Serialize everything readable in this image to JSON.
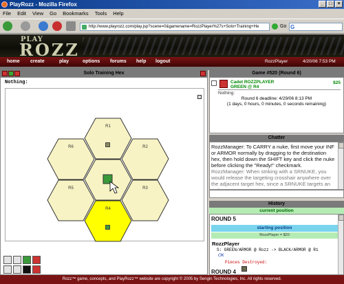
{
  "window": {
    "title": "PlayRozz - Mozilla Firefox",
    "buttons": [
      "_",
      "□",
      "×"
    ]
  },
  "menu": [
    "File",
    "Edit",
    "View",
    "Go",
    "Bookmarks",
    "Tools",
    "Help"
  ],
  "address": {
    "url": "http://www.playrozz.com/play.jsp?scene=0&gamename=RozzPlayer%27s+Solo+Training+He",
    "go_label": "Go",
    "search_placeholder": ""
  },
  "banner": {
    "logo_top": "PLAY",
    "logo_main": "ROZZ"
  },
  "nav": {
    "tabs": [
      "home",
      "create",
      "play",
      "options",
      "forums",
      "help",
      "logout"
    ],
    "user": "RozzPlayer",
    "datetime": "4/20/06 7:53 PM"
  },
  "board": {
    "title": "Solo Training Hex",
    "status": "Nothing:",
    "hexes": [
      {
        "label": "R1",
        "fill": "#f7f3c4"
      },
      {
        "label": "R6",
        "fill": "#f7f3c4"
      },
      {
        "label": "R2",
        "fill": "#f7f3c4"
      },
      {
        "label": "",
        "fill": "#f7f3c4"
      },
      {
        "label": "R5",
        "fill": "#f7f3c4"
      },
      {
        "label": "R3",
        "fill": "#f7f3c4"
      },
      {
        "label": "R4",
        "fill": "#ffff00"
      }
    ]
  },
  "game": {
    "title": "Game #520 (Round 6)",
    "player_rank": "Cadet ROZZPLAYER",
    "player_unit": "GREEN @ R4",
    "cash": "$25",
    "status": "Nothing:",
    "deadline": "Round 6 deadline: 4/29/06 8:13 PM",
    "remaining": "(1 days, 0 hours, 0 minutes, 0 seconds remaining)"
  },
  "chat": {
    "title": "Chatter",
    "text": "RozzManager: To CARRY a nuke, first move your INF or ARMOR normally by dragging to the destination hex, then hold down the SHIFT key and click the nuke before clicking the \"Ready!\" checkmark.",
    "faded": "RozzManager: When striking with a SRNUKE, you would release the targeting crosshair anywhere over the adjacent target hex, since a SRNUKE targets an entire"
  },
  "history": {
    "title": "History",
    "current": "current position",
    "round5": "ROUND 5",
    "starting": "starting position",
    "cash_line": "RozzPlayer = $20",
    "player": "RozzPlayer",
    "move": "S: GREEN/ARMOR @ Rozz -> BLACK/ARMOR @ R1",
    "ok": "OK",
    "destroyed": "Pieces Destroyed:",
    "round4": "ROUND 4"
  },
  "footer": "Rozz™ game, concepts, and PlayRozz™ website are copyright © 2005 by Sengin Technologies, Inc. All rights reserved."
}
